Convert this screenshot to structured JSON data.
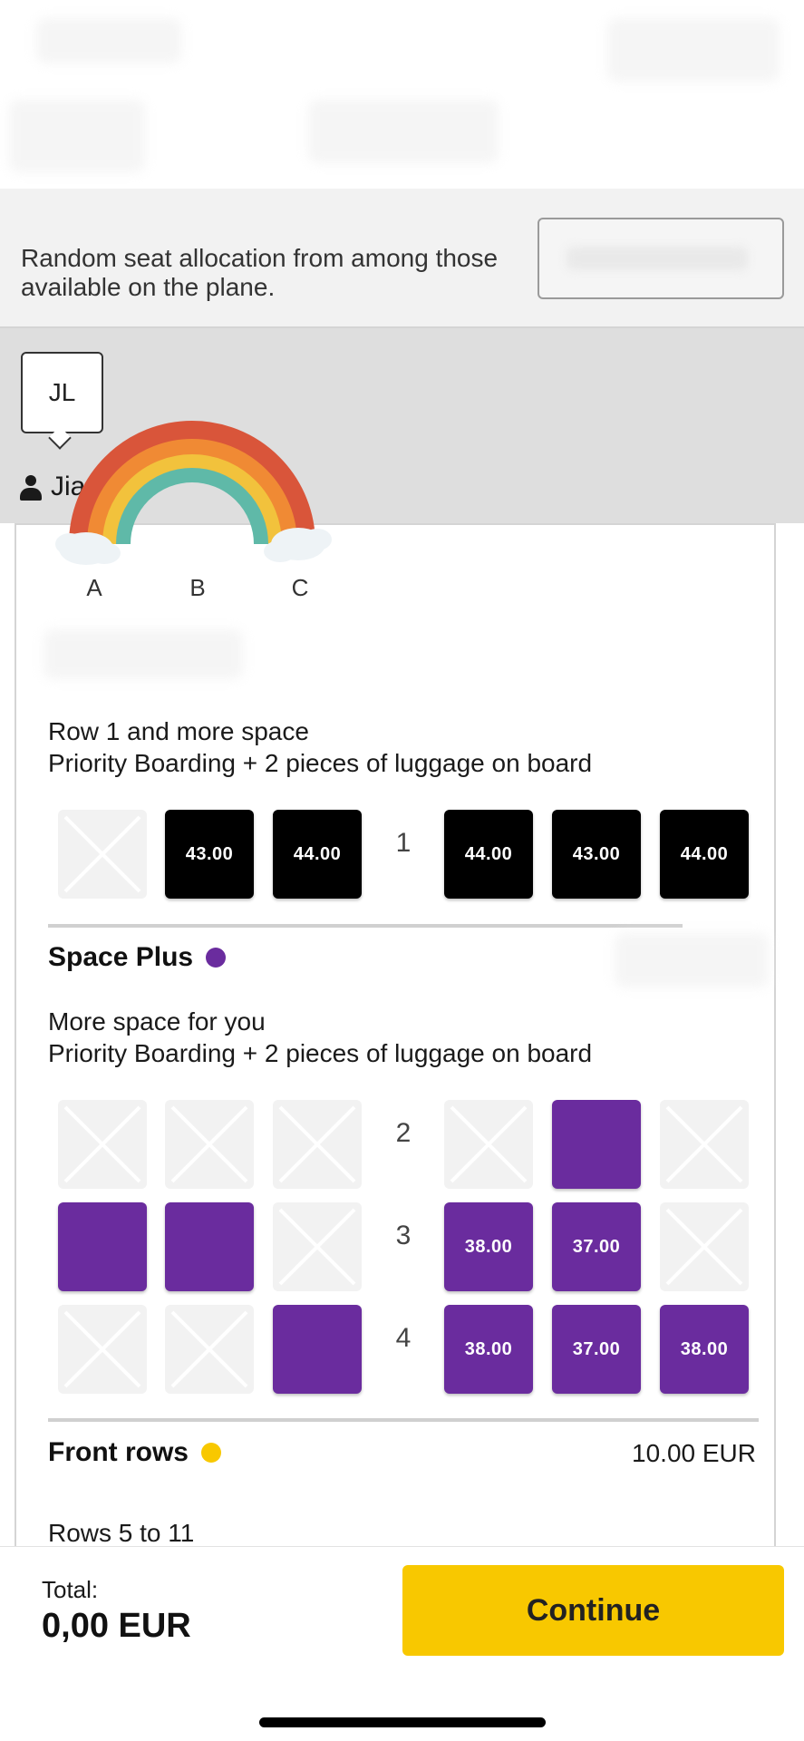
{
  "random_seat": {
    "text": "Random seat allocation from among those available on the plane."
  },
  "passenger": {
    "initials": "JL",
    "name": "Jiao"
  },
  "columns": [
    "A",
    "B",
    "C"
  ],
  "row1_section": {
    "line1": "Row 1 and more space",
    "line2": "Priority Boarding + 2 pieces of luggage on board",
    "row_number": "1",
    "prices": [
      "43.00",
      "44.00",
      "44.00",
      "43.00",
      "44.00"
    ]
  },
  "space_plus": {
    "title": "Space Plus",
    "dot_color": "#6a2c9e",
    "line1": "More space for you",
    "line2": "Priority Boarding + 2 pieces of luggage on board",
    "rows": [
      "2",
      "3",
      "4"
    ],
    "prices": {
      "r3_d": "38.00",
      "r3_e": "37.00",
      "r4_d": "38.00",
      "r4_e": "37.00",
      "r4_f": "38.00"
    }
  },
  "front_rows": {
    "title": "Front rows",
    "dot_color": "#f8c800",
    "price": "10.00  EUR",
    "rows_text": "Rows 5 to 11"
  },
  "footer": {
    "total_label": "Total:",
    "total_value": "0,00 EUR",
    "continue_label": "Continue"
  },
  "colors": {
    "accent_yellow": "#f8c800",
    "seat_purple": "#6a2c9e",
    "seat_black": "#000000"
  }
}
